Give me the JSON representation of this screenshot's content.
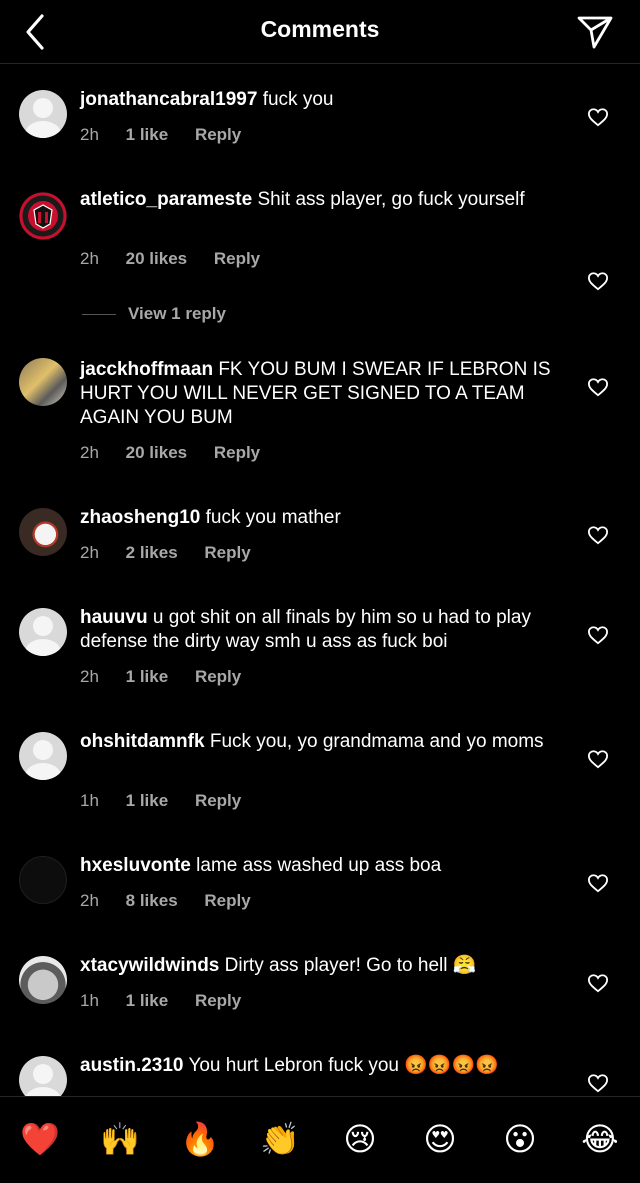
{
  "header": {
    "title": "Comments"
  },
  "comments": [
    {
      "username": "jonathancabral1997",
      "text": "fuck you",
      "time": "2h",
      "likes": "1 like",
      "reply": "Reply",
      "avatar": "default-avatar-icon"
    },
    {
      "username": "atletico_parameste",
      "text": "Shit ass player, go fuck yourself",
      "time": "2h",
      "likes": "20 likes",
      "reply": "Reply",
      "avatar": "club-crest-avatar",
      "view_replies": "View 1 reply"
    },
    {
      "username": "jacckhoffmaan",
      "text": "FK YOU BUM I SWEAR IF LEBRON IS HURT YOU WILL NEVER GET SIGNED TO A TEAM AGAIN YOU BUM",
      "time": "2h",
      "likes": "20 likes",
      "reply": "Reply",
      "avatar": "photo-avatar"
    },
    {
      "username": "zhaosheng10",
      "text": "fuck you mather",
      "time": "2h",
      "likes": "2 likes",
      "reply": "Reply",
      "avatar": "photo-avatar"
    },
    {
      "username": "hauuvu",
      "text": "u got shit on all finals by him so u had to play defense the dirty way smh u ass as fuck boi",
      "time": "2h",
      "likes": "1 like",
      "reply": "Reply",
      "avatar": "default-avatar-icon"
    },
    {
      "username": "ohshitdamnfk",
      "text": "Fuck you, yo grandmama and yo moms",
      "time": "1h",
      "likes": "1 like",
      "reply": "Reply",
      "avatar": "default-avatar-icon"
    },
    {
      "username": "hxesluvonte",
      "text": "lame ass washed up ass boa",
      "time": "2h",
      "likes": "8 likes",
      "reply": "Reply",
      "avatar": "dark-avatar"
    },
    {
      "username": "xtacywildwinds",
      "text": "Dirty ass player! Go to hell 😤",
      "time": "1h",
      "likes": "1 like",
      "reply": "Reply",
      "avatar": "photo-avatar"
    },
    {
      "username": "austin.2310",
      "text": "You hurt Lebron fuck you 😡😡😡😡",
      "time": "",
      "likes": "",
      "reply": "",
      "avatar": "default-avatar-icon"
    }
  ],
  "emoji_bar": [
    "❤️",
    "🙌",
    "🔥",
    "👏",
    "😢",
    "😍",
    "😮",
    "😂"
  ],
  "colors": {
    "background": "#000000",
    "text": "#ffffff",
    "meta": "#a8a8a8",
    "divider": "#262626"
  }
}
